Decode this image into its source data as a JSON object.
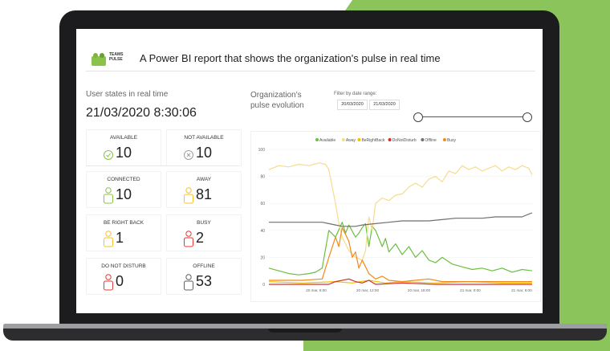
{
  "report": {
    "logo_text_line1": "TEAMS",
    "logo_text_line2": "PULSE",
    "title": "A Power BI report that shows the organization's pulse in real time"
  },
  "user_states": {
    "title": "User states in real time",
    "datetime": "21/03/2020 8:30:06",
    "cards": [
      {
        "label": "AVAILABLE",
        "value": "10",
        "icon": "check-circle-icon",
        "color": "#8bc34a"
      },
      {
        "label": "NOT AVAILABLE",
        "value": "10",
        "icon": "x-circle-icon",
        "color": "#9e9e9e"
      },
      {
        "label": "CONNECTED",
        "value": "10",
        "icon": "user-check-icon",
        "color": "#8bc34a"
      },
      {
        "label": "AWAY",
        "value": "81",
        "icon": "user-clock-icon",
        "color": "#fbc02d"
      },
      {
        "label": "BE RIGHT BACK",
        "value": "1",
        "icon": "user-pause-icon",
        "color": "#fbc02d"
      },
      {
        "label": "BUSY",
        "value": "2",
        "icon": "user-busy-icon",
        "color": "#e53935"
      },
      {
        "label": "DO NOT DISTURB",
        "value": "0",
        "icon": "user-dnd-icon",
        "color": "#e53935"
      },
      {
        "label": "OFFLINE",
        "value": "53",
        "icon": "user-offline-icon",
        "color": "#616161"
      }
    ]
  },
  "pulse": {
    "title_line1": "Organization's",
    "title_line2": "pulse evolution",
    "filter_label": "Filter by date range:",
    "date_from": "20/03/2020",
    "date_to": "21/03/2020"
  },
  "chart_data": {
    "type": "line",
    "ylim": [
      0,
      100
    ],
    "yticks": [
      "0",
      "20",
      "40",
      "60",
      "80",
      "100"
    ],
    "xticks": [
      "20 mar, 6:00",
      "20 mar, 12:00",
      "20 mar, 18:00",
      "21 mar, 0:00",
      "21 mar, 6:00"
    ],
    "series": [
      {
        "name": "Available",
        "color": "#6abf40",
        "points": [
          [
            0,
            12
          ],
          [
            3,
            10
          ],
          [
            6,
            8
          ],
          [
            9,
            7
          ],
          [
            12,
            8
          ],
          [
            14,
            9
          ],
          [
            16,
            12
          ],
          [
            18,
            40
          ],
          [
            20,
            35
          ],
          [
            22,
            46
          ],
          [
            23,
            38
          ],
          [
            24,
            44
          ],
          [
            26,
            35
          ],
          [
            27,
            38
          ],
          [
            28,
            42
          ],
          [
            29,
            45
          ],
          [
            30,
            28
          ],
          [
            31,
            43
          ],
          [
            32,
            40
          ],
          [
            34,
            28
          ],
          [
            35,
            34
          ],
          [
            36,
            24
          ],
          [
            38,
            30
          ],
          [
            40,
            22
          ],
          [
            42,
            28
          ],
          [
            44,
            20
          ],
          [
            46,
            25
          ],
          [
            48,
            18
          ],
          [
            50,
            16
          ],
          [
            52,
            20
          ],
          [
            55,
            15
          ],
          [
            58,
            13
          ],
          [
            61,
            11
          ],
          [
            64,
            12
          ],
          [
            67,
            10
          ],
          [
            70,
            12
          ],
          [
            73,
            9
          ],
          [
            76,
            11
          ],
          [
            79,
            10
          ]
        ]
      },
      {
        "name": "Away",
        "color": "#f5dc8c",
        "points": [
          [
            0,
            85
          ],
          [
            3,
            88
          ],
          [
            6,
            87
          ],
          [
            9,
            89
          ],
          [
            12,
            88
          ],
          [
            15,
            90
          ],
          [
            17,
            89
          ],
          [
            18,
            85
          ],
          [
            20,
            60
          ],
          [
            21,
            45
          ],
          [
            22,
            35
          ],
          [
            24,
            25
          ],
          [
            26,
            20
          ],
          [
            28,
            18
          ],
          [
            29,
            25
          ],
          [
            30,
            50
          ],
          [
            31,
            40
          ],
          [
            32,
            60
          ],
          [
            34,
            64
          ],
          [
            36,
            62
          ],
          [
            38,
            66
          ],
          [
            40,
            67
          ],
          [
            42,
            72
          ],
          [
            44,
            75
          ],
          [
            46,
            72
          ],
          [
            48,
            78
          ],
          [
            50,
            80
          ],
          [
            52,
            76
          ],
          [
            54,
            84
          ],
          [
            56,
            82
          ],
          [
            58,
            88
          ],
          [
            60,
            85
          ],
          [
            62,
            87
          ],
          [
            64,
            84
          ],
          [
            66,
            86
          ],
          [
            68,
            88
          ],
          [
            70,
            84
          ],
          [
            72,
            87
          ],
          [
            74,
            85
          ],
          [
            76,
            88
          ],
          [
            78,
            86
          ],
          [
            79,
            81
          ]
        ]
      },
      {
        "name": "BeRightBack",
        "color": "#f2c200",
        "points": [
          [
            0,
            2
          ],
          [
            10,
            1
          ],
          [
            20,
            2
          ],
          [
            25,
            1
          ],
          [
            30,
            3
          ],
          [
            35,
            1
          ],
          [
            40,
            2
          ],
          [
            50,
            1
          ],
          [
            60,
            2
          ],
          [
            70,
            1
          ],
          [
            79,
            1
          ]
        ]
      },
      {
        "name": "DoNotDisturb",
        "color": "#d32f2f",
        "points": [
          [
            0,
            0
          ],
          [
            18,
            0
          ],
          [
            20,
            2
          ],
          [
            24,
            4
          ],
          [
            26,
            2
          ],
          [
            28,
            1
          ],
          [
            30,
            3
          ],
          [
            32,
            0
          ],
          [
            40,
            1
          ],
          [
            50,
            0
          ],
          [
            60,
            0
          ],
          [
            70,
            0
          ],
          [
            79,
            0
          ]
        ]
      },
      {
        "name": "Offline",
        "color": "#6f6f6f",
        "points": [
          [
            0,
            46
          ],
          [
            10,
            46
          ],
          [
            16,
            46
          ],
          [
            18,
            45
          ],
          [
            20,
            44
          ],
          [
            22,
            43
          ],
          [
            26,
            43
          ],
          [
            28,
            44
          ],
          [
            32,
            45
          ],
          [
            36,
            46
          ],
          [
            40,
            47
          ],
          [
            44,
            47
          ],
          [
            48,
            47
          ],
          [
            52,
            48
          ],
          [
            56,
            49
          ],
          [
            60,
            49
          ],
          [
            64,
            49
          ],
          [
            68,
            50
          ],
          [
            72,
            50
          ],
          [
            76,
            50
          ],
          [
            78,
            52
          ],
          [
            79,
            53
          ]
        ]
      },
      {
        "name": "Busy",
        "color": "#f08a1c",
        "points": [
          [
            0,
            3
          ],
          [
            10,
            3
          ],
          [
            16,
            4
          ],
          [
            18,
            20
          ],
          [
            20,
            35
          ],
          [
            21,
            28
          ],
          [
            22,
            42
          ],
          [
            24,
            32
          ],
          [
            25,
            20
          ],
          [
            26,
            24
          ],
          [
            27,
            12
          ],
          [
            28,
            18
          ],
          [
            30,
            8
          ],
          [
            32,
            4
          ],
          [
            34,
            6
          ],
          [
            36,
            3
          ],
          [
            40,
            2
          ],
          [
            48,
            4
          ],
          [
            52,
            2
          ],
          [
            60,
            2
          ],
          [
            70,
            2
          ],
          [
            79,
            2
          ]
        ]
      }
    ]
  }
}
